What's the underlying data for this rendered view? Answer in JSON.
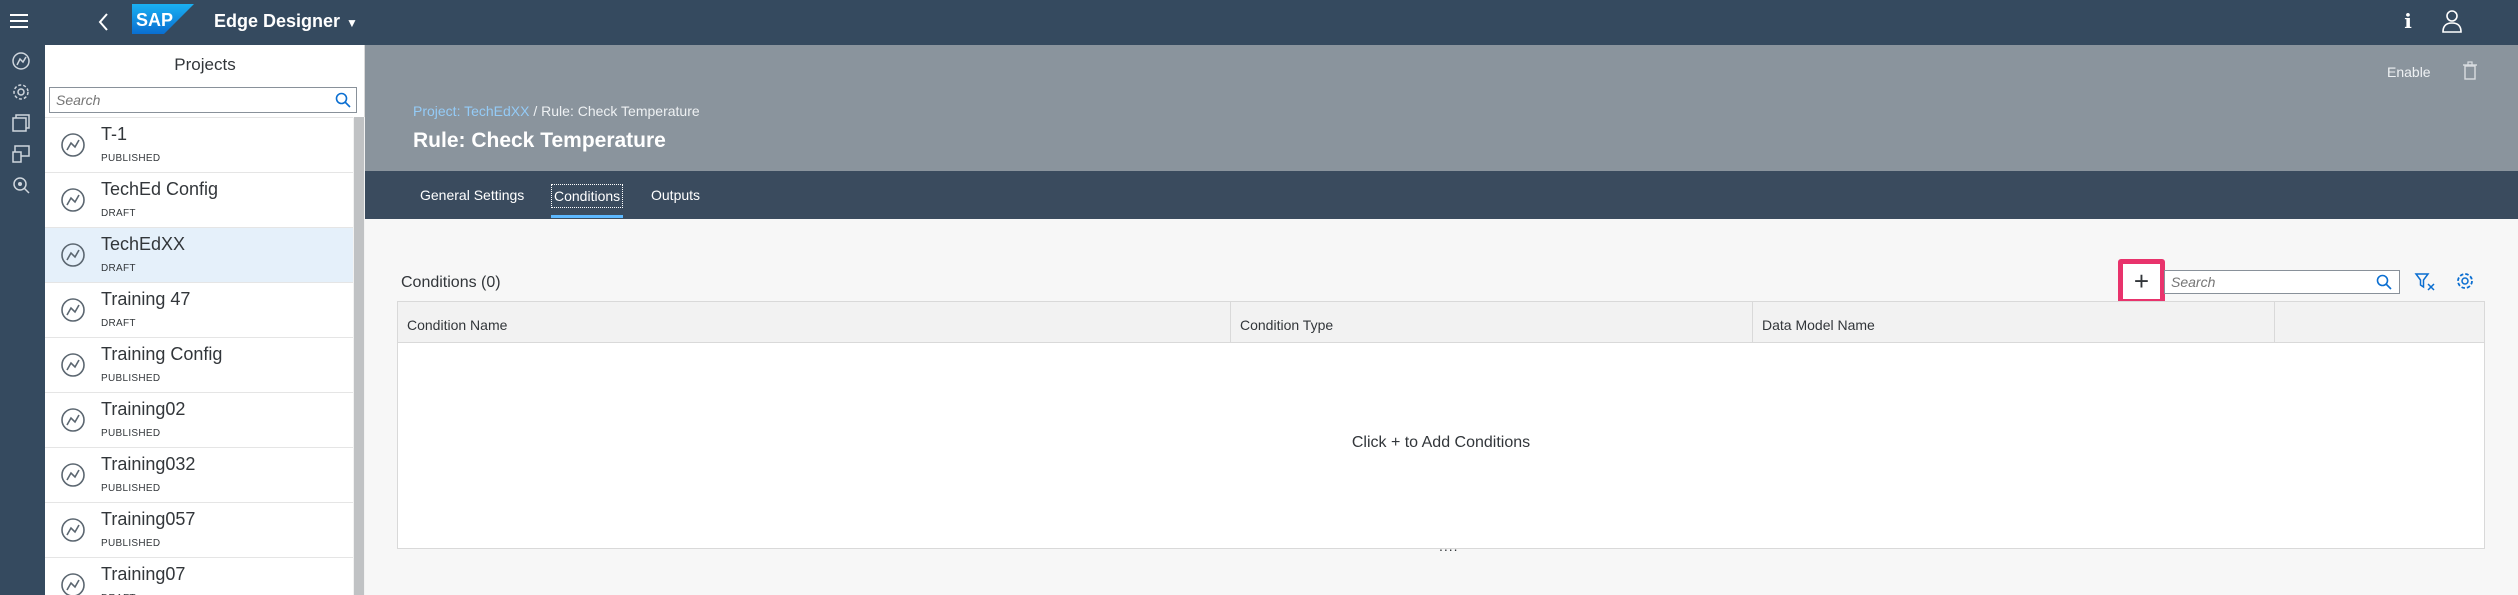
{
  "shell": {
    "app_title": "Edge Designer",
    "logo_text": "SAP",
    "icons": [
      "menu-icon",
      "back-icon",
      "info-icon",
      "user-icon"
    ]
  },
  "sidenav": {
    "icons": [
      "projects-icon",
      "settings-icon",
      "library-icon",
      "devices-icon",
      "search-settings-icon"
    ]
  },
  "projects": {
    "title": "Projects",
    "search_placeholder": "Search",
    "items": [
      {
        "name": "T-1",
        "status": "PUBLISHED"
      },
      {
        "name": "TechEd Config",
        "status": "DRAFT"
      },
      {
        "name": "TechEdXX",
        "status": "DRAFT"
      },
      {
        "name": "Training 47",
        "status": "DRAFT"
      },
      {
        "name": "Training Config",
        "status": "PUBLISHED"
      },
      {
        "name": "Training02",
        "status": "PUBLISHED"
      },
      {
        "name": "Training032",
        "status": "PUBLISHED"
      },
      {
        "name": "Training057",
        "status": "PUBLISHED"
      },
      {
        "name": "Training07",
        "status": "DRAFT"
      }
    ],
    "selected_index": 2
  },
  "header": {
    "enable_label": "Enable",
    "breadcrumb_link": "Project: TechEdXX",
    "breadcrumb_separator": " / ",
    "breadcrumb_current": "Rule: Check Temperature",
    "title": "Rule: Check Temperature"
  },
  "tabs": [
    {
      "label": "General Settings"
    },
    {
      "label": "Conditions"
    },
    {
      "label": "Outputs"
    }
  ],
  "conditions": {
    "title": "Conditions (0)",
    "add_label": "+",
    "search_placeholder": "Search",
    "columns": [
      "Condition Name",
      "Condition Type",
      "Data Model Name",
      ""
    ],
    "no_data": "Click + to Add Conditions",
    "more_indicator": "...."
  },
  "colors": {
    "shell": "#354a5f",
    "header": "#8a949d",
    "tabbar": "#3a4b5e",
    "highlight": "#e8336c",
    "link": "#94cbf7"
  }
}
